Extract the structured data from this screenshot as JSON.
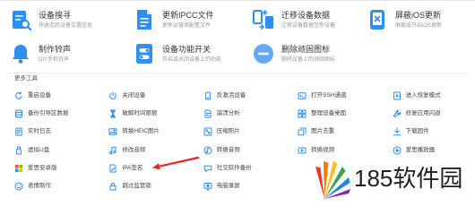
{
  "colors": {
    "accent": "#2e8ef2",
    "arrow": "#e8262a",
    "title": "#333333",
    "subtitle": "#9a9a9a"
  },
  "cards": [
    {
      "title": "设备搜寻",
      "subtitle": "快速追踪设备位置信息",
      "icon": "device-search-icon"
    },
    {
      "title": "更新IPCC文件",
      "subtitle": "更新运营商配置文件",
      "icon": "ipcc-file-icon"
    },
    {
      "title": "迁移设备数据",
      "subtitle": "迁移设备数据至新设备",
      "icon": "data-migration-icon"
    },
    {
      "title": "屏蔽iOS更新",
      "subtitle": "屏蔽或开启iOS更新",
      "icon": "block-update-icon"
    },
    {
      "title": "制作铃声",
      "subtitle": "DIY手机铃声",
      "icon": "ringtone-icon"
    },
    {
      "title": "设备功能开关",
      "subtitle": "开启或关闭设备上的功能",
      "icon": "feature-toggle-icon"
    },
    {
      "title": "删除顽固图标",
      "subtitle": "删除设备上的顽固图标",
      "icon": "delete-icon"
    }
  ],
  "more_tools": {
    "heading": "更多工具",
    "items": [
      {
        "label": "重启设备",
        "icon": "restart-icon"
      },
      {
        "label": "关闭设备",
        "icon": "power-icon"
      },
      {
        "label": "反激活设备",
        "icon": "deactivate-icon"
      },
      {
        "label": "打开SSH通道",
        "icon": "ssh-icon"
      },
      {
        "label": "进入恢复模式",
        "icon": "recovery-mode-icon"
      },
      {
        "label": "备份引导区数据",
        "icon": "backup-icon"
      },
      {
        "label": "破解时间限额",
        "icon": "hourglass-icon"
      },
      {
        "label": "崩溃分析",
        "icon": "crash-analysis-icon"
      },
      {
        "label": "整理设备桌面",
        "icon": "desktop-organize-icon"
      },
      {
        "label": "修复应用闪退",
        "icon": "repair-icon"
      },
      {
        "label": "实时日志",
        "icon": "log-icon"
      },
      {
        "label": "转换HEIC图片",
        "icon": "heic-image-icon"
      },
      {
        "label": "压缩照片",
        "icon": "compress-photo-icon"
      },
      {
        "label": "图片去重",
        "icon": "duplicate-image-icon"
      },
      {
        "label": "下载固件",
        "icon": "firmware-download-icon"
      },
      {
        "label": "虚拟U盘",
        "icon": "usb-drive-icon"
      },
      {
        "label": "修改音频",
        "icon": "audio-edit-icon"
      },
      {
        "label": "转换音频",
        "icon": "audio-convert-icon"
      },
      {
        "label": "转换视频",
        "icon": "video-convert-icon"
      },
      {
        "label": "爱思播放器",
        "icon": "player-icon"
      },
      {
        "label": "爱思安卓版",
        "icon": "android-icon"
      },
      {
        "label": "IPA签名",
        "icon": "ipa-sign-icon"
      },
      {
        "label": "社交软件备份",
        "icon": "social-backup-icon"
      },
      {
        "label": "表情制作",
        "icon": "emoji-icon"
      },
      {
        "label": "跳过监管锁",
        "icon": "skip-lock-icon"
      },
      {
        "label": "电脑录屏",
        "icon": "screen-record-icon"
      }
    ]
  },
  "watermark": {
    "text": "185软件园"
  }
}
